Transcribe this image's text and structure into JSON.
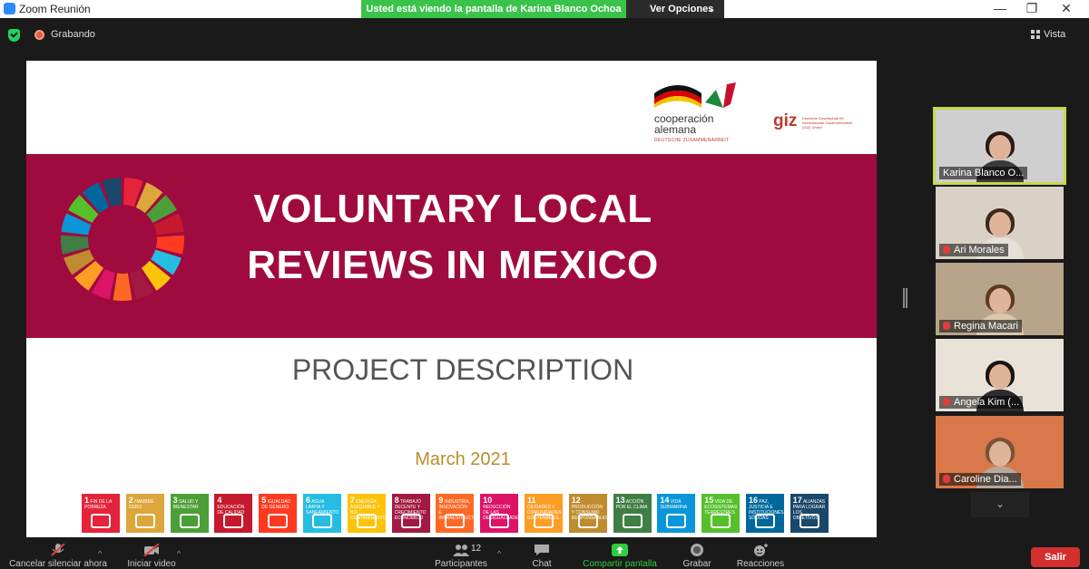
{
  "window": {
    "title": "Zoom Reunión",
    "share_banner": "Usted está viendo la pantalla de Karina Blanco Ochoa",
    "view_options": "Ver Opciones",
    "minimize": "—",
    "restore": "❐",
    "close": "✕"
  },
  "topbar": {
    "recording": "Grabando",
    "view": "Vista"
  },
  "slide": {
    "title_line1": "VOLUNTARY LOCAL",
    "title_line2": "REVIEWS IN MEXICO",
    "subtitle": "PROJECT DESCRIPTION",
    "date": "March 2021",
    "logo_cooperacion": "cooperación",
    "logo_alemana": "alemana",
    "logo_deutsche": "DEUTSCHE ZUSAMMENARBEIT",
    "logo_giz": "giz",
    "logo_giz_sub": "Deutsche Gesellschaft für Internationale Zusammenarbeit (GIZ) GmbH",
    "sdgs": [
      {
        "n": "1",
        "t": "FIN DE LA POBREZA",
        "color": "#e5243b"
      },
      {
        "n": "2",
        "t": "HAMBRE CERO",
        "color": "#dda63a"
      },
      {
        "n": "3",
        "t": "SALUD Y BIENESTAR",
        "color": "#4c9f38"
      },
      {
        "n": "4",
        "t": "EDUCACIÓN DE CALIDAD",
        "color": "#c5192d"
      },
      {
        "n": "5",
        "t": "IGUALDAD DE GÉNERO",
        "color": "#ff3a21"
      },
      {
        "n": "6",
        "t": "AGUA LIMPIA Y SANEAMIENTO",
        "color": "#26bde2"
      },
      {
        "n": "7",
        "t": "ENERGÍA ASEQUIBLE Y NO CONTAMINANTE",
        "color": "#fcc30b"
      },
      {
        "n": "8",
        "t": "TRABAJO DECENTE Y CRECIMIENTO ECONÓMICO",
        "color": "#a21942"
      },
      {
        "n": "9",
        "t": "INDUSTRIA, INNOVACIÓN E INFRAESTRUCTURA",
        "color": "#fd6925"
      },
      {
        "n": "10",
        "t": "REDUCCIÓN DE LAS DESIGUALDADES",
        "color": "#dd1367"
      },
      {
        "n": "11",
        "t": "CIUDADES Y COMUNIDADES SOSTENIBLES",
        "color": "#fd9d24"
      },
      {
        "n": "12",
        "t": "PRODUCCIÓN Y CONSUMO RESPONSABLES",
        "color": "#bf8b2e"
      },
      {
        "n": "13",
        "t": "ACCIÓN POR EL CLIMA",
        "color": "#3f7e44"
      },
      {
        "n": "14",
        "t": "VIDA SUBMARINA",
        "color": "#0a97d9"
      },
      {
        "n": "15",
        "t": "VIDA DE ECOSISTEMAS TERRESTRES",
        "color": "#56c02b"
      },
      {
        "n": "16",
        "t": "PAZ, JUSTICIA E INSTITUCIONES SÓLIDAS",
        "color": "#00689d"
      },
      {
        "n": "17",
        "t": "ALIANZAS PARA LOGRAR LOS OBJETIVOS",
        "color": "#19486a"
      }
    ]
  },
  "participants": [
    {
      "name": "Karina Blanco O...",
      "muted": false,
      "active": true,
      "bg": "#cfcfcf",
      "hair": "#2a1b14",
      "body": "#3a3a3a"
    },
    {
      "name": "Ari Morales",
      "muted": true,
      "active": false,
      "bg": "#d9d2c4",
      "hair": "#3a2a20",
      "body": "#e5e0d8"
    },
    {
      "name": "Regina Macari",
      "muted": true,
      "active": false,
      "bg": "#b7a48a",
      "hair": "#5a3a22",
      "body": "#d7c7ad"
    },
    {
      "name": "Angela Kim (...",
      "muted": true,
      "active": false,
      "bg": "#e8e2d8",
      "hair": "#1a1410",
      "body": "#2d2d2d"
    },
    {
      "name": "Caroline Dia...",
      "muted": true,
      "active": false,
      "bg": "#d9784a",
      "hair": "#7a5234",
      "body": "#b8a89a"
    }
  ],
  "toolbar": {
    "mute": "Cancelar silenciar ahora",
    "video": "Iniciar video",
    "participants": "Participantes",
    "participants_count": "12",
    "chat": "Chat",
    "share": "Compartir pantalla",
    "record": "Grabar",
    "reactions": "Reacciones",
    "leave": "Salir"
  },
  "colors": {
    "banner": "#a00b3f",
    "share_banner": "#3ac34a",
    "leave": "#d32f2f",
    "date": "#b8902a"
  }
}
